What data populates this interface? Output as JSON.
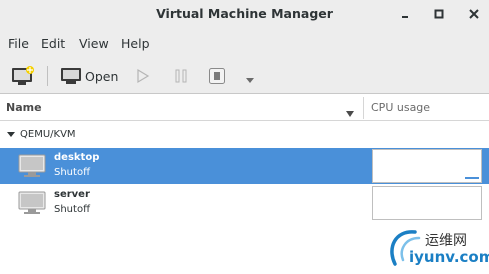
{
  "window": {
    "title": "Virtual Machine Manager",
    "controls": {
      "minimize": "_",
      "maximize": "□",
      "close": "×"
    }
  },
  "menubar": {
    "items": [
      "File",
      "Edit",
      "View",
      "Help"
    ]
  },
  "toolbar": {
    "open_label": "Open",
    "icons": [
      "new-vm-icon",
      "open-console-icon",
      "run-icon",
      "pause-icon",
      "shutdown-icon",
      "dropdown-arrow-icon"
    ]
  },
  "table": {
    "columns": {
      "name": "Name",
      "cpu": "CPU usage"
    },
    "group": {
      "label": "QEMU/KVM",
      "expanded": true
    },
    "vms": [
      {
        "name": "desktop",
        "state": "Shutoff",
        "selected": true
      },
      {
        "name": "server",
        "state": "Shutoff",
        "selected": false
      }
    ]
  },
  "watermark": {
    "chinese": "运维网",
    "url": "iyunv.com"
  },
  "colors": {
    "selection": "#4a90d9",
    "chrome": "#ededed",
    "watermark_blue": "#1b7fc4"
  }
}
